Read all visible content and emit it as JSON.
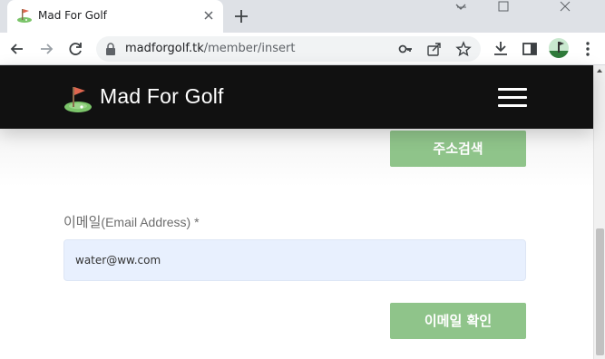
{
  "browser": {
    "tab": {
      "title": "Mad For Golf"
    },
    "address": {
      "host": "madforgolf.tk",
      "path": "/member/insert"
    }
  },
  "site": {
    "name": "Mad For Golf"
  },
  "form": {
    "address_search_label": "주소검색",
    "email_label": "이메일",
    "email_label_sub": "(Email Address) *",
    "email_value": "water@ww.com",
    "email_check_label": "이메일 확인"
  },
  "colors": {
    "header_bg": "#111111",
    "button_green": "#8fc48a",
    "input_bg": "#e8f0fe"
  },
  "icons": {
    "favicon": "golf-flag-icon",
    "tab_close": "close-icon",
    "new_tab": "plus-icon",
    "back": "arrow-left-icon",
    "forward": "arrow-right-icon",
    "reload": "reload-icon",
    "lock": "lock-icon",
    "key": "key-icon",
    "share": "share-icon",
    "bookmark": "star-icon",
    "download": "download-icon",
    "sidepanel": "side-panel-icon",
    "menu": "hamburger-menu-icon"
  }
}
